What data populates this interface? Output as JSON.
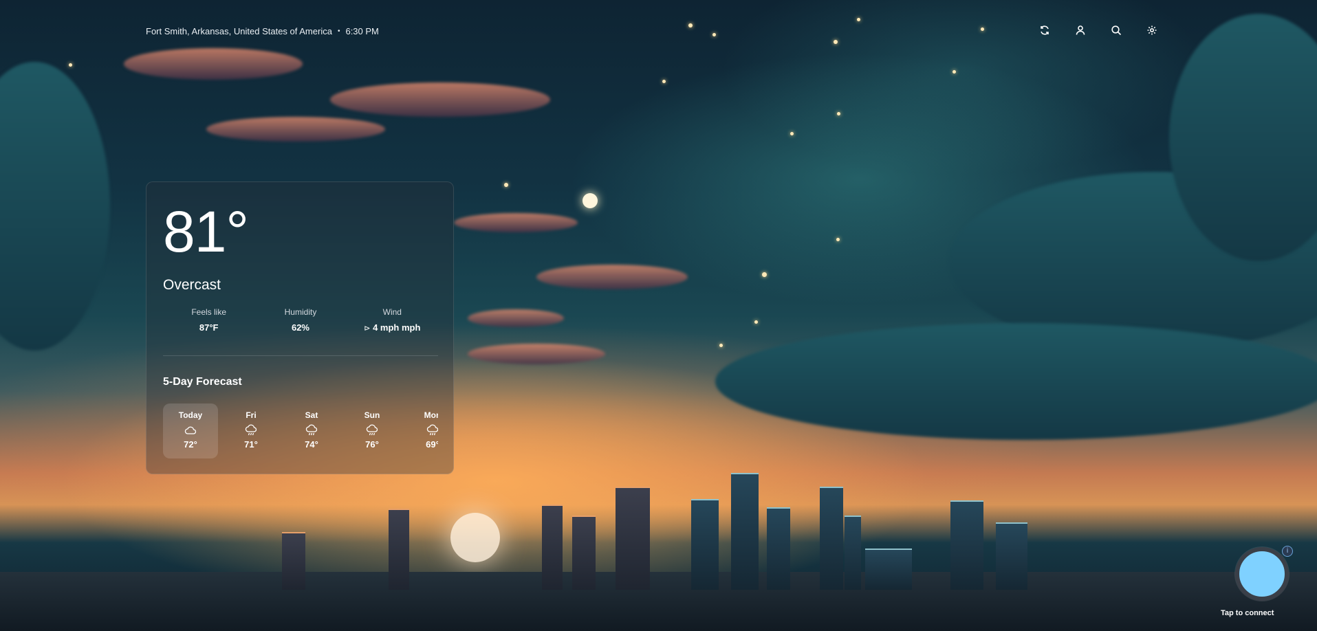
{
  "header": {
    "location": "Fort Smith, Arkansas, United States of America",
    "separator": "•",
    "time": "6:30 PM",
    "actions": [
      {
        "name": "refresh",
        "icon": "refresh-icon"
      },
      {
        "name": "account",
        "icon": "user-icon"
      },
      {
        "name": "search",
        "icon": "search-icon"
      },
      {
        "name": "settings",
        "icon": "gear-icon"
      }
    ]
  },
  "current": {
    "temperature": "81°",
    "condition": "Overcast",
    "stats": [
      {
        "label": "Feels like",
        "value": "87°F"
      },
      {
        "label": "Humidity",
        "value": "62%"
      },
      {
        "label": "Wind",
        "arrow": "⊳",
        "value": "4 mph mph"
      }
    ]
  },
  "forecast": {
    "title": "5-Day Forecast",
    "days": [
      {
        "name": "Today",
        "icon": "cloud-icon",
        "temp": "72°"
      },
      {
        "name": "Fri",
        "icon": "rain-cloud-icon",
        "temp": "71°"
      },
      {
        "name": "Sat",
        "icon": "rain-cloud-icon",
        "temp": "74°"
      },
      {
        "name": "Sun",
        "icon": "rain-cloud-icon",
        "temp": "76°"
      },
      {
        "name": "Mon",
        "icon": "rain-cloud-icon",
        "temp": "69°"
      }
    ]
  },
  "assistant": {
    "info_glyph": "i",
    "label": "Tap to connect",
    "orb_color": "#7fd1ff"
  }
}
